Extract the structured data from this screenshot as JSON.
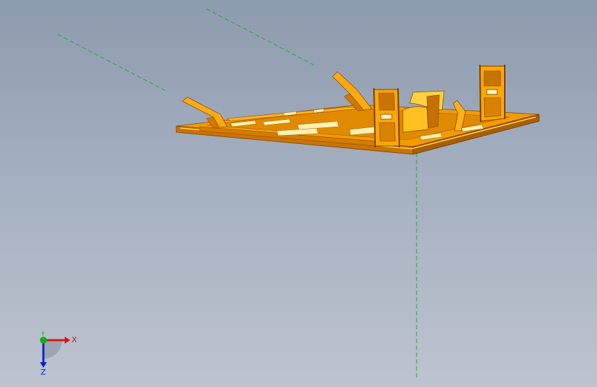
{
  "viewport": {
    "background_top": "#8d9bae",
    "background_bottom": "#bcc4cf"
  },
  "model": {
    "part_color": "#f7a800",
    "part_dark": "#b86a00",
    "part_highlight": "#ffe07a",
    "part_pale": "#fff2b8"
  },
  "reference_lines": {
    "color": "#1ea82a"
  },
  "triad": {
    "x_label": "X",
    "y_label": "Y",
    "z_label": "Z",
    "x_color": "#e01010",
    "y_color": "#10b010",
    "z_color": "#1020d0"
  }
}
